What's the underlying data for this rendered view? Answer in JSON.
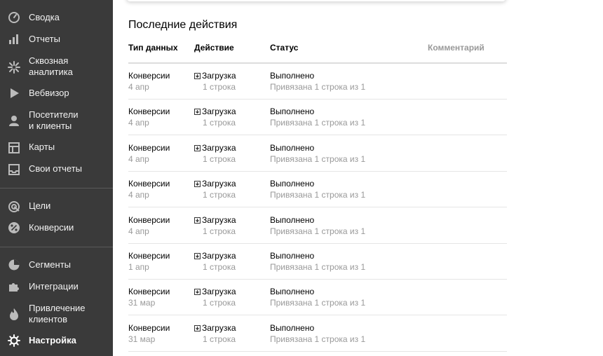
{
  "sidebar": {
    "items": [
      {
        "label": "Сводка",
        "icon": "dashboard-gauge-icon"
      },
      {
        "label": "Отчеты",
        "icon": "bar-chart-icon"
      },
      {
        "label": "Сквозная\nаналитика",
        "icon": "end-to-end-analytics-icon"
      },
      {
        "label": "Вебвизор",
        "icon": "play-icon"
      },
      {
        "label": "Посетители\nи клиенты",
        "icon": "person-icon"
      },
      {
        "label": "Карты",
        "icon": "map-layout-icon"
      },
      {
        "label": "Свои отчеты",
        "icon": "inbox-tray-icon"
      },
      {
        "label": "Цели",
        "icon": "goal-target-icon"
      },
      {
        "label": "Конверсии",
        "icon": "percent-icon"
      },
      {
        "label": "Сегменты",
        "icon": "pie-segment-icon"
      },
      {
        "label": "Интеграции",
        "icon": "puzzle-icon"
      },
      {
        "label": "Привлечение\nклиентов",
        "icon": "flame-icon"
      },
      {
        "label": "Настройка",
        "icon": "gear-icon",
        "active": true
      }
    ]
  },
  "recent_actions": {
    "title": "Последние действия",
    "columns": {
      "type": "Тип данных",
      "action": "Действие",
      "status": "Статус",
      "comment": "Комментарий"
    },
    "rows": [
      {
        "type": "Конверсии",
        "date": "4 апр",
        "action": "Загрузка",
        "count": "1 строка",
        "status": "Выполнено",
        "detail": "Привязана 1 строка из 1"
      },
      {
        "type": "Конверсии",
        "date": "4 апр",
        "action": "Загрузка",
        "count": "1 строка",
        "status": "Выполнено",
        "detail": "Привязана 1 строка из 1"
      },
      {
        "type": "Конверсии",
        "date": "4 апр",
        "action": "Загрузка",
        "count": "1 строка",
        "status": "Выполнено",
        "detail": "Привязана 1 строка из 1"
      },
      {
        "type": "Конверсии",
        "date": "4 апр",
        "action": "Загрузка",
        "count": "1 строка",
        "status": "Выполнено",
        "detail": "Привязана 1 строка из 1"
      },
      {
        "type": "Конверсии",
        "date": "4 апр",
        "action": "Загрузка",
        "count": "1 строка",
        "status": "Выполнено",
        "detail": "Привязана 1 строка из 1"
      },
      {
        "type": "Конверсии",
        "date": "1 апр",
        "action": "Загрузка",
        "count": "1 строка",
        "status": "Выполнено",
        "detail": "Привязана 1 строка из 1"
      },
      {
        "type": "Конверсии",
        "date": "31 мар",
        "action": "Загрузка",
        "count": "1 строка",
        "status": "Выполнено",
        "detail": "Привязана 1 строка из 1"
      },
      {
        "type": "Конверсии",
        "date": "31 мар",
        "action": "Загрузка",
        "count": "1 строка",
        "status": "Выполнено",
        "detail": "Привязана 1 строка из 1"
      }
    ]
  }
}
